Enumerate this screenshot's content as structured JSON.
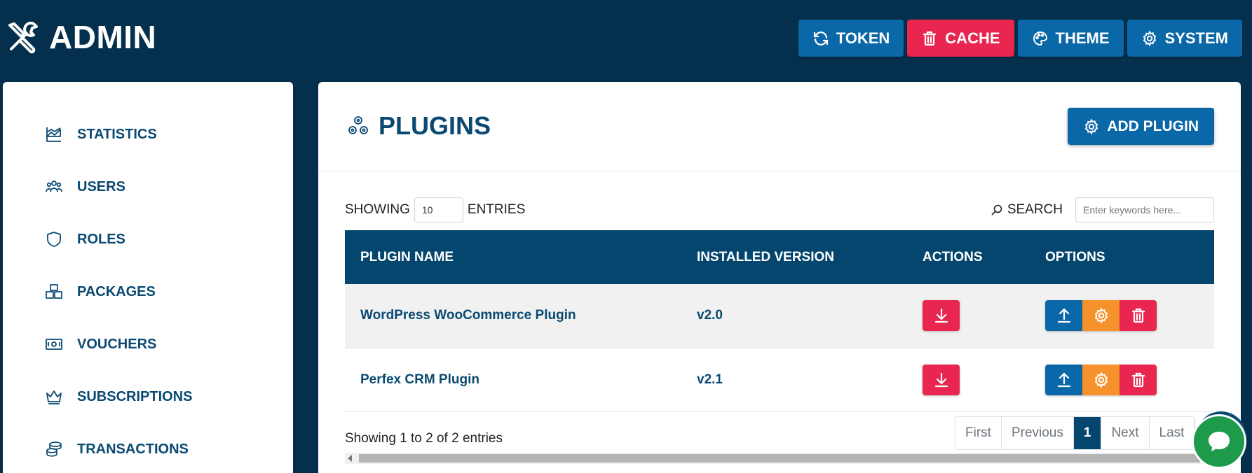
{
  "header": {
    "brand": "ADMIN",
    "buttons": [
      {
        "label": "TOKEN",
        "icon": "refresh-icon",
        "color": "#0a67a8"
      },
      {
        "label": "CACHE",
        "icon": "trash-icon",
        "color": "#e8264f"
      },
      {
        "label": "THEME",
        "icon": "palette-icon",
        "color": "#0a67a8"
      },
      {
        "label": "SYSTEM",
        "icon": "gear-icon",
        "color": "#0a67a8"
      }
    ]
  },
  "sidebar": {
    "items": [
      {
        "label": "STATISTICS",
        "icon": "chart-area-icon"
      },
      {
        "label": "USERS",
        "icon": "users-icon"
      },
      {
        "label": "ROLES",
        "icon": "shield-icon"
      },
      {
        "label": "PACKAGES",
        "icon": "boxes-icon"
      },
      {
        "label": "VOUCHERS",
        "icon": "money-icon"
      },
      {
        "label": "SUBSCRIPTIONS",
        "icon": "crown-icon"
      },
      {
        "label": "TRANSACTIONS",
        "icon": "coins-icon"
      }
    ]
  },
  "main": {
    "title": "PLUGINS",
    "add_button": "ADD PLUGIN",
    "showing_label": "SHOWING",
    "entries_value": "10",
    "entries_label": "ENTRIES",
    "search_label": "SEARCH",
    "search_placeholder": "Enter keywords here...",
    "columns": [
      "PLUGIN NAME",
      "INSTALLED VERSION",
      "ACTIONS",
      "OPTIONS"
    ],
    "rows": [
      {
        "name": "WordPress WooCommerce Plugin",
        "version": "v2.0"
      },
      {
        "name": "Perfex CRM Plugin",
        "version": "v2.1"
      }
    ],
    "info": "Showing 1 to 2 of 2 entries",
    "pagination": [
      "First",
      "Previous",
      "1",
      "Next",
      "Last"
    ]
  },
  "colors": {
    "background": "#05304d",
    "primary": "#0a67a8",
    "danger": "#e8264f",
    "warning": "#f5922b",
    "table_header": "#05466e"
  }
}
